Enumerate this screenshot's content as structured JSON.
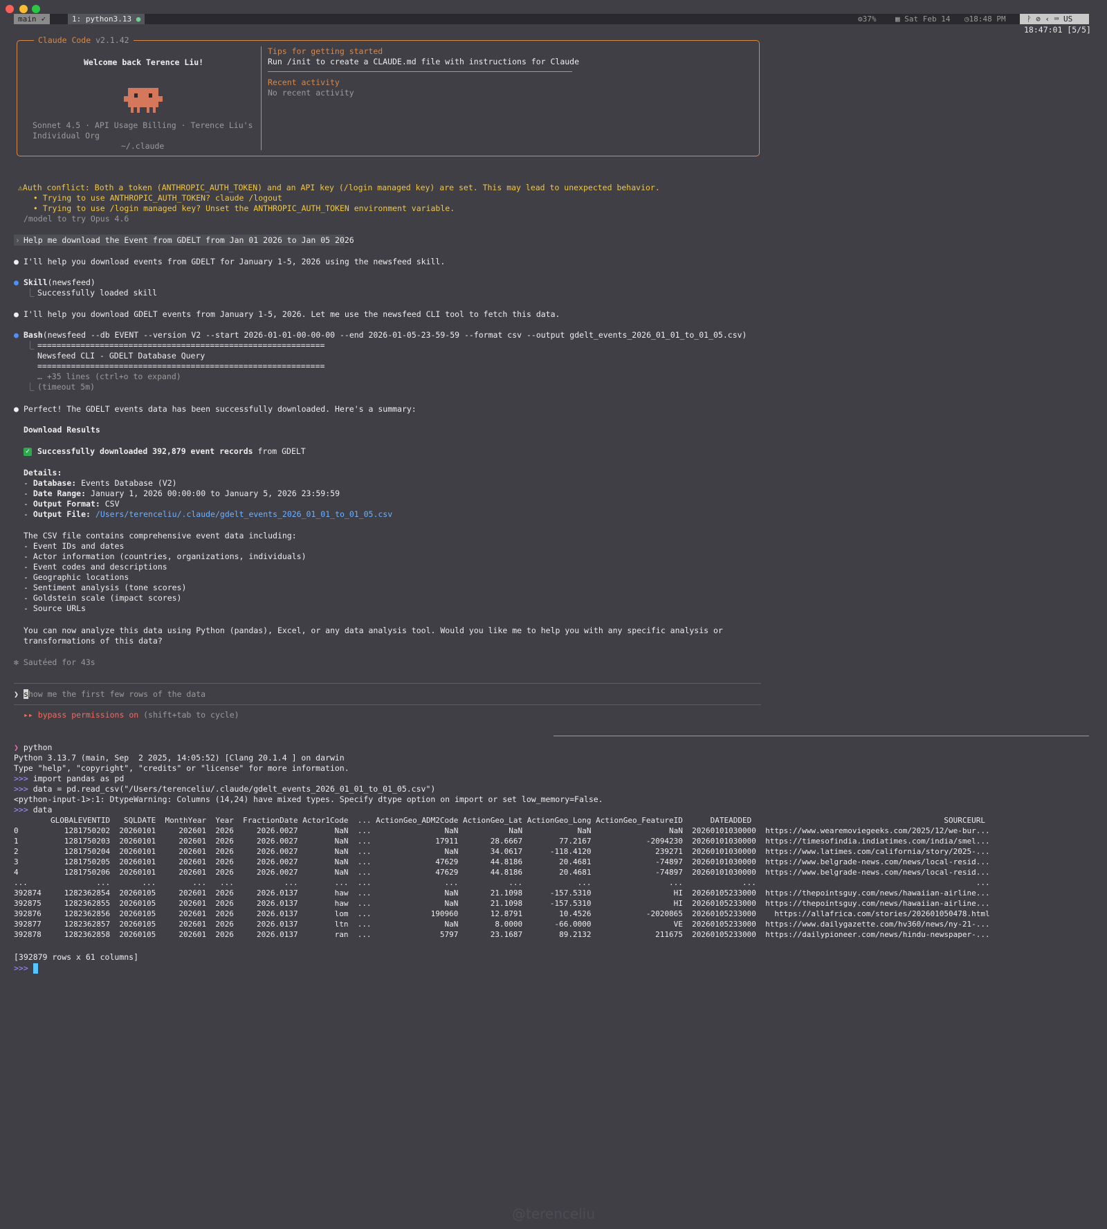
{
  "tabbar": {
    "session": "main",
    "window": "1: python3.13",
    "cpu": "37%",
    "date": "Sat Feb 14",
    "time": "18:48 PM",
    "layout": "US",
    "pane_clock": "18:47:01 [5/5]"
  },
  "welcome": {
    "title": "Claude Code",
    "version": "v2.1.42",
    "greeting": "Welcome back Terence Liu!",
    "account_line1": "Sonnet 4.5 · API Usage Billing · Terence Liu's",
    "account_line2": "Individual Org",
    "cwd": "~/.claude",
    "tips_title": "Tips for getting started",
    "tips_text": "Run /init to create a CLAUDE.md file with instructions for Claude",
    "recent_title": "Recent activity",
    "recent_text": "No recent activity"
  },
  "warning": {
    "line1": "⚠Auth conflict: Both a token (ANTHROPIC_AUTH_TOKEN) and an API key (/login managed key) are set. This may lead to unexpected behavior.",
    "line2": "  • Trying to use ANTHROPIC_AUTH_TOKEN? claude /logout",
    "line3": "  • Trying to use /login managed key? Unset the ANTHROPIC_AUTH_TOKEN environment variable.",
    "model_hint": "/model to try Opus 4.6"
  },
  "chat": {
    "user_prompt": "Help me download the Event from GDELT from Jan 01 2026 to Jan 05 2026",
    "msg1": "I'll help you download events from GDELT for January 1-5, 2026 using the newsfeed skill.",
    "skill_name": "Skill",
    "skill_arg": "(newsfeed)",
    "skill_result": "Successfully loaded skill",
    "msg2": "I'll help you download GDELT events from January 1-5, 2026. Let me use the newsfeed CLI tool to fetch this data.",
    "bash_name": "Bash",
    "bash_cmd": "(newsfeed --db EVENT --version V2 --start 2026-01-01-00-00-00 --end 2026-01-05-23-59-59 --format csv --output gdelt_events_2026_01_01_to_01_05.csv)",
    "bash_out1": "============================================================",
    "bash_out2": "Newsfeed CLI - GDELT Database Query",
    "bash_out3": "============================================================",
    "bash_more": "… +35 lines (ctrl+o to expand)",
    "bash_timeout": "(timeout 5m)",
    "msg3": "Perfect! The GDELT events data has been successfully downloaded. Here's a summary:",
    "results_title": "Download Results",
    "check_icon": "check-mark-icon",
    "success_bold": "Successfully downloaded 392,879 event records",
    "success_rest": " from GDELT",
    "details_title": "Details:",
    "details": [
      {
        "key": "Database",
        "value": " Events Database (V2)"
      },
      {
        "key": "Date Range",
        "value": " January 1, 2026 00:00:00 to January 5, 2026 23:59:59"
      },
      {
        "key": "Output Format",
        "value": " CSV"
      },
      {
        "key": "Output File",
        "value": " /Users/terenceliu/.claude/gdelt_events_2026_01_01_to_01_05.csv"
      }
    ],
    "csv_intro": "The CSV file contains comprehensive event data including:",
    "csv_items": [
      "- Event IDs and dates",
      "- Actor information (countries, organizations, individuals)",
      "- Event codes and descriptions",
      "- Geographic locations",
      "- Sentiment analysis (tone scores)",
      "- Goldstein scale (impact scores)",
      "- Source URLs"
    ],
    "closing1": "You can now analyze this data using Python (pandas), Excel, or any data analysis tool. Would you like me to help you with any specific analysis or",
    "closing2": "transformations of this data?",
    "sauteed": "✻ Sautéed for 43s",
    "input_cursor_char": "s",
    "input_placeholder": "how me the first few rows of the data",
    "bypass_label": "▸▸ bypass permissions on",
    "bypass_hint": " (shift+tab to cycle)"
  },
  "terminal": {
    "prompt_cmd": "python",
    "python_banner1": "Python 3.13.7 (main, Sep  2 2025, 14:05:52) [Clang 20.1.4 ] on darwin",
    "python_banner2": "Type \"help\", \"copyright\", \"credits\" or \"license\" for more information.",
    "ps1": ">>>",
    "cmd1": " import pandas as pd",
    "cmd2": " data = pd.read_csv(\"/Users/terenceliu/.claude/gdelt_events_2026_01_01_to_01_05.csv\")",
    "warning": "<python-input-1>:1: DtypeWarning: Columns (14,24) have mixed types. Specify dtype option on import or set low_memory=False.",
    "cmd3": " data",
    "df_header": "        GLOBALEVENTID   SQLDATE  MonthYear  Year  FractionDate Actor1Code  ... ActionGeo_ADM2Code ActionGeo_Lat ActionGeo_Long ActionGeo_FeatureID      DATEADDED                                          SOURCEURL",
    "df_rows": [
      "0          1281750202  20260101     202601  2026     2026.0027        NaN  ...                NaN           NaN            NaN                 NaN  20260101030000  https://www.wearemoviegeeks.com/2025/12/we-bur...",
      "1          1281750203  20260101     202601  2026     2026.0027        NaN  ...              17911       28.6667        77.2167            -2094230  20260101030000  https://timesofindia.indiatimes.com/india/smel...",
      "2          1281750204  20260101     202601  2026     2026.0027        NaN  ...                NaN       34.0617      -118.4120              239271  20260101030000  https://www.latimes.com/california/story/2025-...",
      "3          1281750205  20260101     202601  2026     2026.0027        NaN  ...              47629       44.8186        20.4681              -74897  20260101030000  https://www.belgrade-news.com/news/local-resid...",
      "4          1281750206  20260101     202601  2026     2026.0027        NaN  ...              47629       44.8186        20.4681              -74897  20260101030000  https://www.belgrade-news.com/news/local-resid...",
      "...               ...       ...        ...   ...           ...        ...  ...                ...           ...            ...                 ...             ...                                                ...",
      "392874     1282362854  20260105     202601  2026     2026.0137        haw  ...                NaN       21.1098      -157.5310                  HI  20260105233000  https://thepointsguy.com/news/hawaiian-airline...",
      "392875     1282362855  20260105     202601  2026     2026.0137        haw  ...                NaN       21.1098      -157.5310                  HI  20260105233000  https://thepointsguy.com/news/hawaiian-airline...",
      "392876     1282362856  20260105     202601  2026     2026.0137        lom  ...             190960       12.8791        10.4526            -2020865  20260105233000    https://allafrica.com/stories/202601050478.html",
      "392877     1282362857  20260105     202601  2026     2026.0137        ltn  ...                NaN        8.0000       -66.0000                  VE  20260105233000  https://www.dailygazette.com/hv360/news/ny-21-...",
      "392878     1282362858  20260105     202601  2026     2026.0137        ran  ...               5797       23.1687        89.2132              211675  20260105233000  https://dailypioneer.com/news/hindu-newspaper-..."
    ],
    "df_shape": "[392879 rows x 61 columns]"
  },
  "watermark": "@terenceliu",
  "colors": {
    "background": "#3f3f45",
    "accent_orange": "#d9894a",
    "warning_yellow": "#f2c744",
    "link_blue": "#6fb0ff",
    "bypass_red": "#f36a5e",
    "prompt_purple": "#a58dff"
  }
}
